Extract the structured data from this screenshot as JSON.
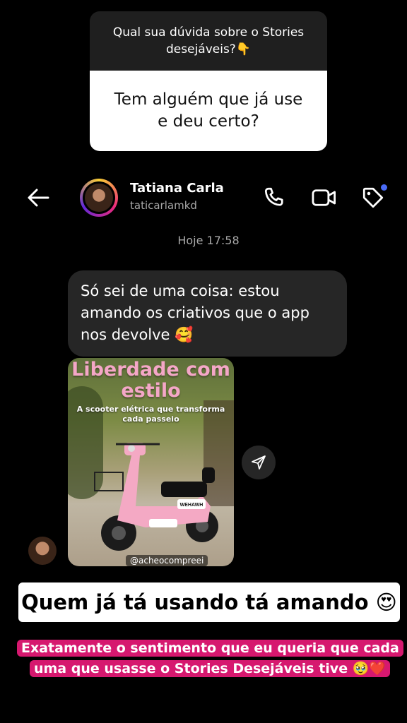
{
  "question_sticker": {
    "prompt": "Qual sua dúvida sobre o Stories desejáveis?👇",
    "answer": "Tem alguém que já use e deu certo?"
  },
  "header": {
    "name": "Tatiana Carla",
    "username": "taticarlamkd",
    "icons": [
      "back-arrow-icon",
      "phone-icon",
      "video-icon",
      "tag-icon"
    ]
  },
  "chat": {
    "timestamp": "Hoje 17:58",
    "message": "Só sei de uma coisa: estou amando os criativos que o app nos devolve 🥰",
    "shared_post": {
      "title": "Liberdade com estilo",
      "subtitle": "A scooter elétrica que transforma cada passeio",
      "brand": "WEHAWH",
      "tag": "@acheocompreei"
    }
  },
  "captions": {
    "line1": "Quem já tá usando tá amando 😍",
    "line2": "Exatamente o sentimento que eu queria que cada uma que usasse o Stories Desejáveis tive 🥹❤️"
  },
  "colors": {
    "background": "#000000",
    "bubble": "#262626",
    "highlight_pink": "#d6186f",
    "post_title_pink": "#f4a7c7"
  }
}
